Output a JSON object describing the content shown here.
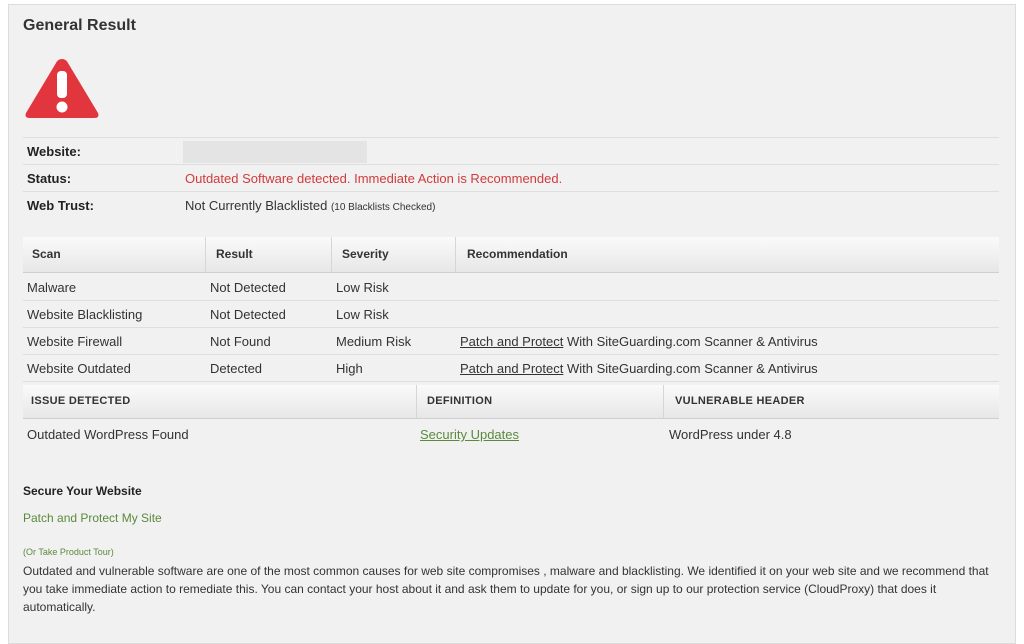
{
  "general": {
    "title": "General Result"
  },
  "info": {
    "website_label": "Website:",
    "status_label": "Status:",
    "status_value": "Outdated Software detected. Immediate Action is Recommended.",
    "webtrust_label": "Web Trust:",
    "webtrust_value": "Not Currently Blacklisted",
    "webtrust_note": "(10 Blacklists Checked)"
  },
  "scan_table": {
    "headers": [
      "Scan",
      "Result",
      "Severity",
      "Recommendation"
    ],
    "rows": [
      {
        "scan": "Malware",
        "result": "Not Detected",
        "severity": "Low Risk",
        "link": "",
        "rest": ""
      },
      {
        "scan": "Website Blacklisting",
        "result": "Not Detected",
        "severity": "Low Risk",
        "link": "",
        "rest": ""
      },
      {
        "scan": "Website Firewall",
        "result": "Not Found",
        "severity": "Medium Risk",
        "link": "Patch and Protect",
        "rest": " With SiteGuarding.com Scanner & Antivirus"
      },
      {
        "scan": "Website Outdated",
        "result": "Detected",
        "severity": "High",
        "link": "Patch and Protect",
        "rest": " With SiteGuarding.com Scanner & Antivirus"
      }
    ]
  },
  "issue_table": {
    "headers": [
      "ISSUE DETECTED",
      "DEFINITION",
      "VULNERABLE HEADER"
    ],
    "row": {
      "issue": "Outdated WordPress Found",
      "definition": "Security Updates",
      "header": "WordPress under 4.8"
    }
  },
  "secure": {
    "heading": "Secure Your Website",
    "patch_link": "Patch and Protect My Site",
    "tour_link": "(Or Take Product Tour)",
    "paragraph": "Outdated and vulnerable software are one of the most common causes for web site compromises , malware and blacklisting. We identified it on your web site and we recommend that you take immediate action to remediate this. You can contact your host about it and ask them to update for you, or sign up to our protection service (CloudProxy) that does it automatically."
  },
  "colors": {
    "alert_red": "#e2363f",
    "status_red": "#d23a3a",
    "link_green": "#5a8a3c"
  },
  "icons": {
    "warning": "warning-triangle-icon"
  }
}
